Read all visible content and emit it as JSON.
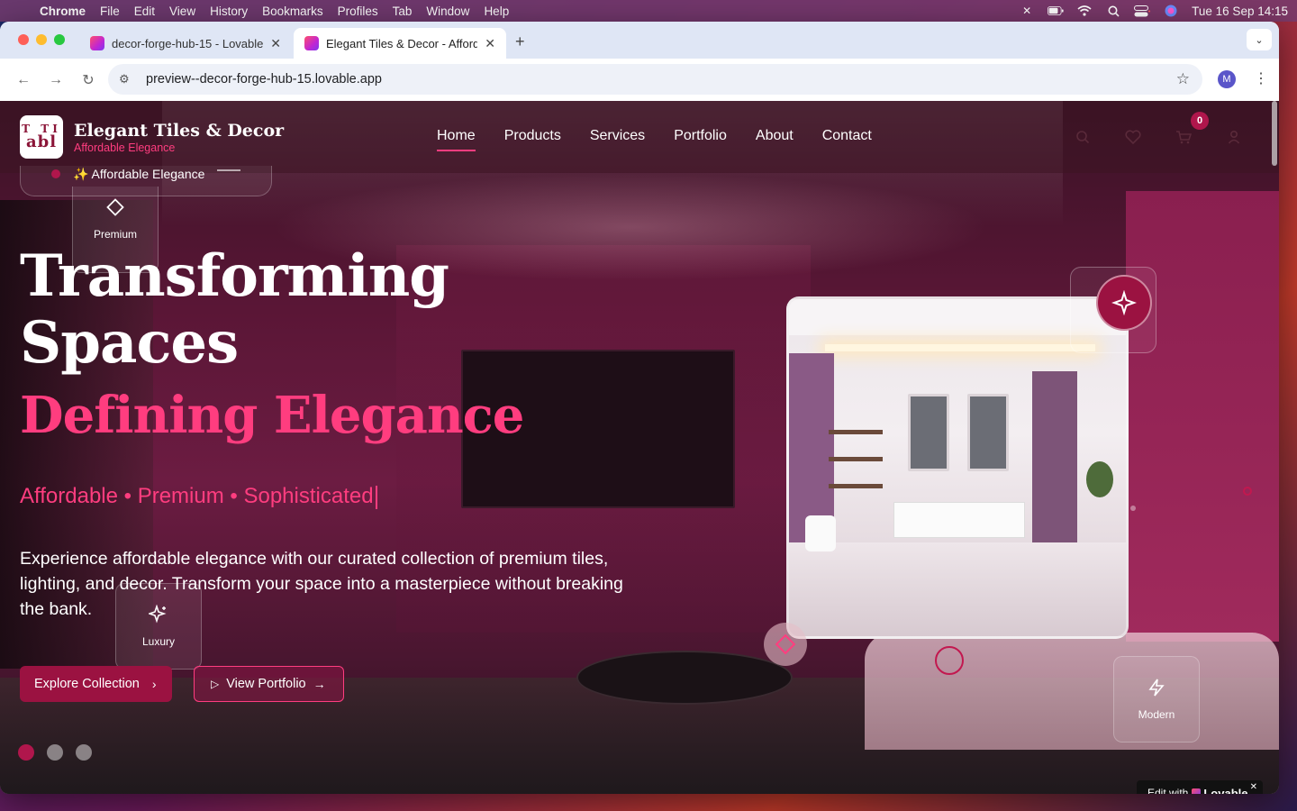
{
  "menubar": {
    "app": "Chrome",
    "items": [
      "File",
      "Edit",
      "View",
      "History",
      "Bookmarks",
      "Profiles",
      "Tab",
      "Window",
      "Help"
    ],
    "datetime": "Tue 16 Sep  14:15"
  },
  "browser": {
    "tabs": [
      {
        "title": "decor-forge-hub-15 - Lovable"
      },
      {
        "title": "Elegant Tiles & Decor - Affordable Elegance"
      }
    ],
    "url": "preview--decor-forge-hub-15.lovable.app",
    "profile_initial": "M"
  },
  "site": {
    "logo": {
      "line1": "T TI",
      "line2": "abl"
    },
    "brand_name": "Elegant Tiles & Decor",
    "brand_tagline": "Affordable Elegance",
    "nav": [
      "Home",
      "Products",
      "Services",
      "Portfolio",
      "About",
      "Contact"
    ],
    "active_nav": "Home",
    "cart_count": "0"
  },
  "hero": {
    "badge": "✨ Affordable Elegance",
    "title_line1": "Transforming",
    "title_line2": "Spaces",
    "title_accent": "Defining Elegance",
    "subtitle": "Affordable • Premium • Sophisticated",
    "description": "Experience affordable elegance with our curated collection of premium tiles, lighting, and decor. Transform your space into a masterpiece without breaking the bank.",
    "primary_cta": "Explore Collection",
    "secondary_cta": "View Portfolio",
    "feature_cards": {
      "premium": "Premium",
      "luxury": "Luxury",
      "modern": "Modern"
    },
    "slide_count": 3,
    "active_slide": 1
  },
  "lovable_badge": {
    "prefix": "Edit with",
    "brand": "Lovable"
  },
  "colors": {
    "accent": "#ff3d7f",
    "primary": "#9b1241",
    "badge": "#b0164c"
  }
}
